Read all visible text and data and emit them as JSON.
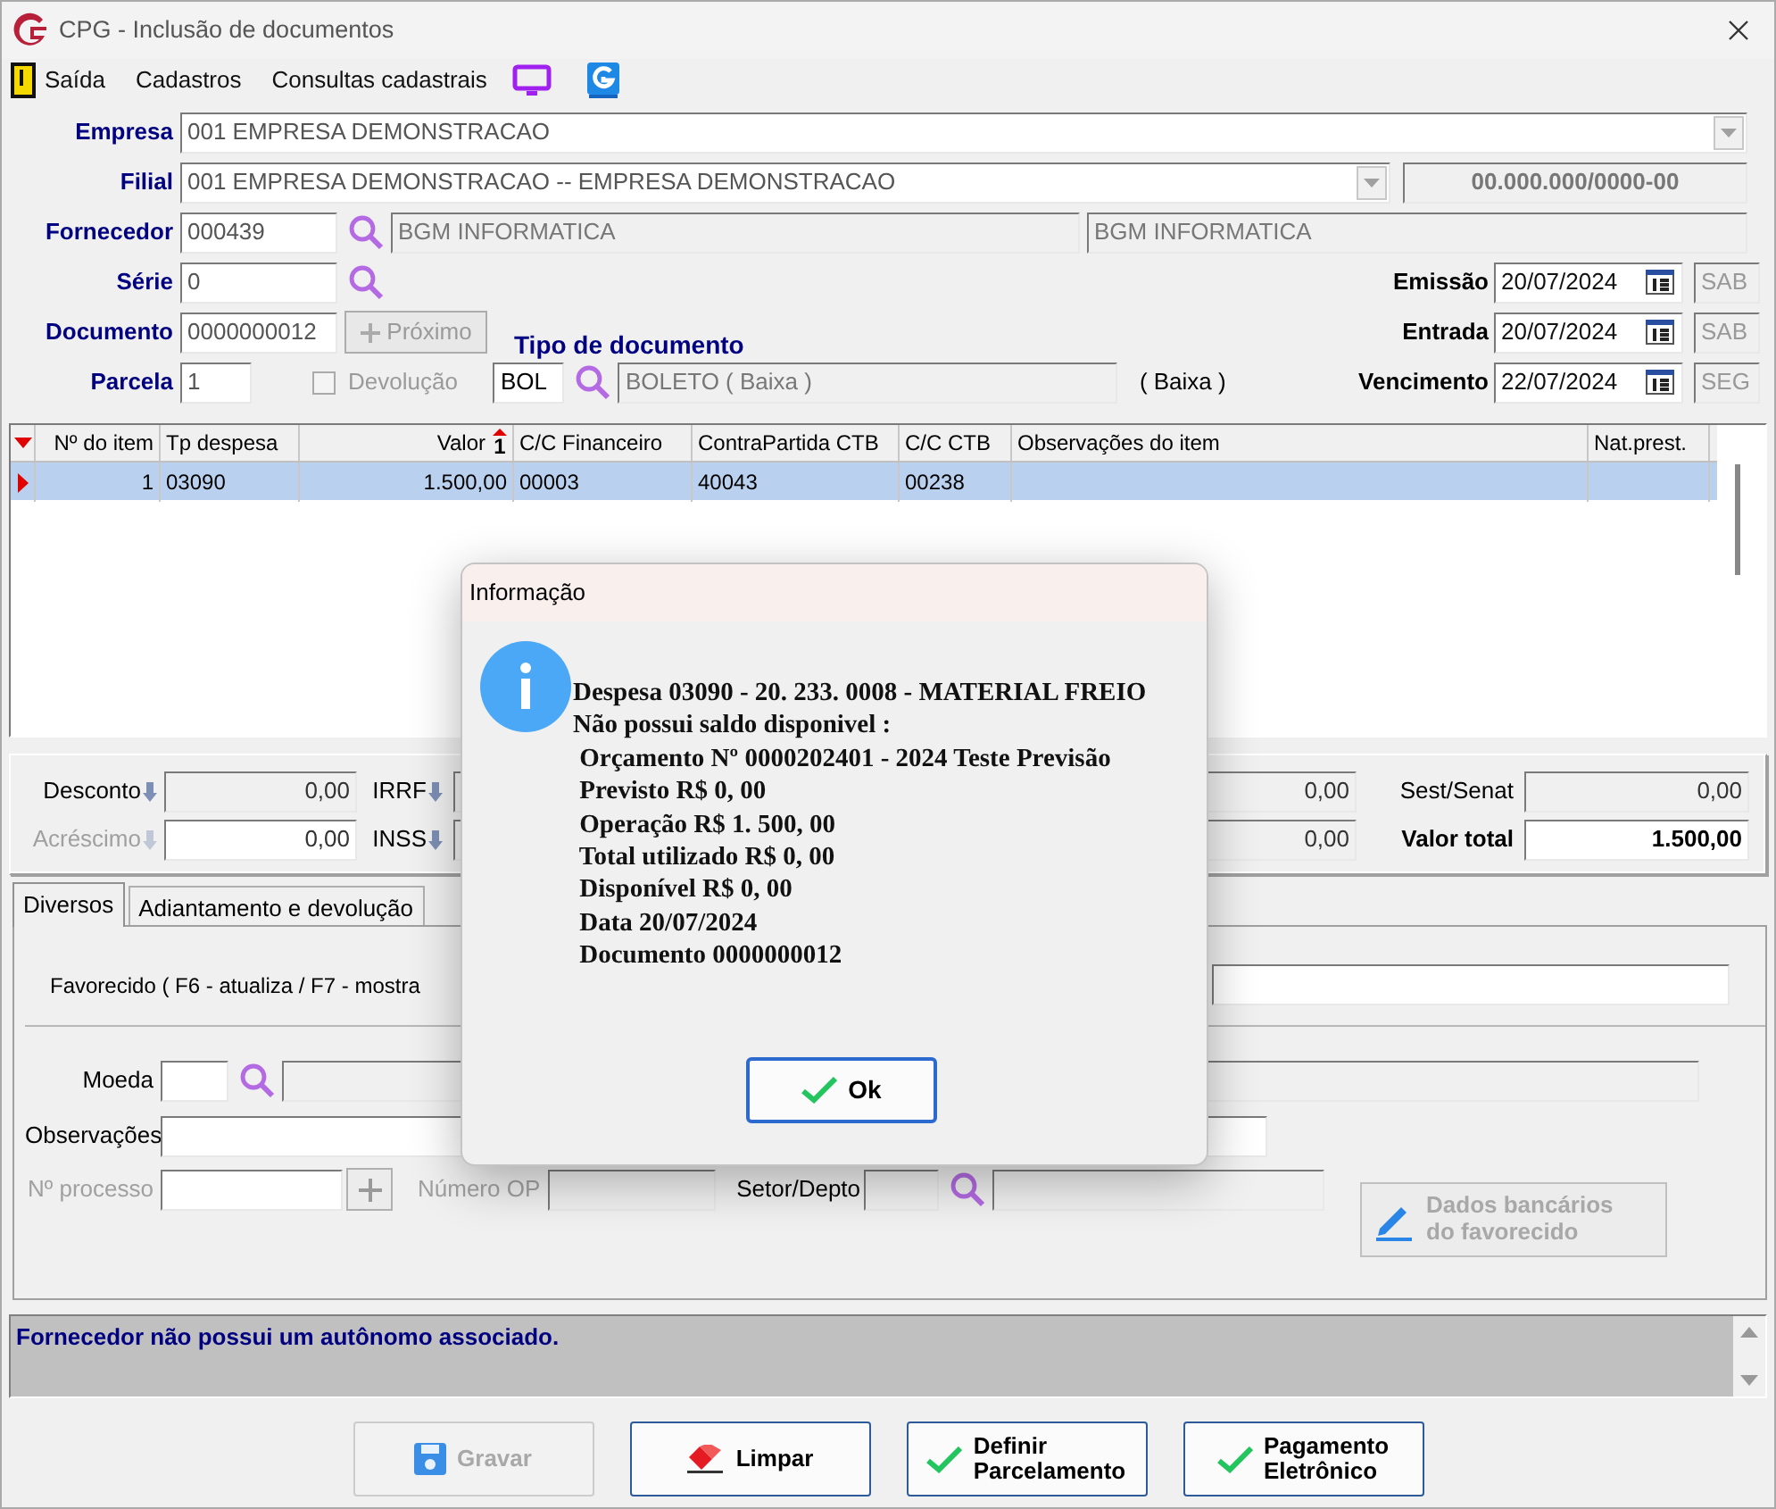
{
  "window": {
    "title": "CPG - Inclusão de documentos"
  },
  "menu": [
    {
      "label": "Saída"
    },
    {
      "label": "Cadastros"
    },
    {
      "label": "Consultas cadastrais"
    }
  ],
  "empresa": {
    "label": "Empresa",
    "value": "001 EMPRESA DEMONSTRACAO"
  },
  "filial": {
    "label": "Filial",
    "value": "001 EMPRESA DEMONSTRACAO -- EMPRESA DEMONSTRACAO",
    "cnpj": "00.000.000/0000-00"
  },
  "fornecedor": {
    "label": "Fornecedor",
    "code": "000439",
    "name": "BGM INFORMATICA",
    "name_2": "BGM INFORMATICA"
  },
  "serie": {
    "label": "Série",
    "value": "0"
  },
  "documento": {
    "label": "Documento",
    "value": "0000000012"
  },
  "proximo_button": {
    "label": "Próximo",
    "disabled": true
  },
  "parcela": {
    "label": "Parcela",
    "value": "1"
  },
  "devolucao": {
    "label": "Devolução",
    "checked": false,
    "disabled": true
  },
  "tipo_documento": {
    "label": "Tipo de documento",
    "code": "BOL",
    "description": "BOLETO ( Baixa )",
    "note": "( Baixa )"
  },
  "dates": [
    {
      "label": "Emissão",
      "value": "20/07/2024",
      "weekday": "SAB"
    },
    {
      "label": "Entrada",
      "value": "20/07/2024",
      "weekday": "SAB"
    },
    {
      "label": "Vencimento",
      "value": "22/07/2024",
      "weekday": "SEG"
    }
  ],
  "items_table": {
    "columns": [
      {
        "label": "Nº do item",
        "numeric": true
      },
      {
        "label": "Tp despesa",
        "numeric": false
      },
      {
        "label": "Valor",
        "numeric": true,
        "sort_order": "1"
      },
      {
        "label": "C/C Financeiro",
        "numeric": false
      },
      {
        "label": "ContraPartida CTB",
        "numeric": false
      },
      {
        "label": "C/C CTB",
        "numeric": false
      },
      {
        "label": "Observações do item",
        "numeric": false
      },
      {
        "label": "Nat.prest.",
        "numeric": false
      }
    ],
    "rows": [
      {
        "cells": [
          "1",
          "03090",
          "1.500,00",
          "00003",
          "40043",
          "00238"
        ],
        "selected": true
      }
    ]
  },
  "totals": [
    {
      "fields": [
        {
          "label": "Desconto",
          "value": "0,00",
          "disabled": false,
          "editable": false,
          "bold": false,
          "arrow": true
        },
        {
          "label": "IRRF",
          "value": "0,00",
          "disabled": false,
          "editable": false,
          "bold": false,
          "arrow": true
        },
        {
          "label": "Sest/Senat",
          "value": "0,00",
          "disabled": false,
          "editable": false,
          "bold": false,
          "arrow": false
        }
      ]
    },
    {
      "fields": [
        {
          "label": "Acréscimo",
          "value": "0,00",
          "disabled": true,
          "editable": true,
          "bold": false,
          "arrow": true
        },
        {
          "label": "INSS",
          "value": "0,00",
          "disabled": false,
          "editable": false,
          "bold": false,
          "arrow": true
        },
        {
          "label": "Valor total",
          "value": "1.500,00",
          "disabled": false,
          "editable": true,
          "bold": true,
          "arrow": false
        }
      ]
    }
  ],
  "tabs": [
    {
      "label": "Diversos",
      "selected": true
    },
    {
      "label": "Adiantamento e devolução",
      "selected": false
    }
  ],
  "diversos": {
    "favorecido_label": "Favorecido ( F6 - atualiza / F7 - mostra",
    "moeda": {
      "label": "Moeda"
    },
    "observacoes": {
      "label": "Observações"
    },
    "processo": {
      "label": "Nº processo",
      "disabled": true
    },
    "numero_op": {
      "label": "Número OP",
      "disabled": true
    },
    "setor": {
      "label": "Setor/Depto"
    },
    "bank_button": {
      "lines": [
        "Dados bancários",
        "do favorecido"
      ],
      "disabled": true
    }
  },
  "status_message": "Fornecedor não possui um autônomo associado.",
  "buttons": [
    {
      "lines": [
        "Gravar"
      ],
      "kind": "save",
      "disabled": true
    },
    {
      "lines": [
        "Limpar"
      ],
      "kind": "clear",
      "disabled": false
    },
    {
      "lines": [
        "Definir",
        "Parcelamento"
      ],
      "kind": "confirm",
      "disabled": false
    },
    {
      "lines": [
        "Pagamento",
        "Eletrônico"
      ],
      "kind": "confirm",
      "disabled": false
    }
  ],
  "dialog": {
    "title": "Informação",
    "lines": [
      "Despesa 03090 - 20. 233. 0008 - MATERIAL FREIO",
      "Não possui saldo disponivel :",
      " Orçamento Nº 0000202401 - 2024 Teste Previsão",
      " Previsto R$ 0, 00",
      " Operação R$ 1. 500, 00",
      " Total utilizado R$ 0, 00",
      " Disponível R$ 0, 00",
      " Data 20/07/2024",
      " Documento 0000000012"
    ],
    "button": "Ok"
  }
}
